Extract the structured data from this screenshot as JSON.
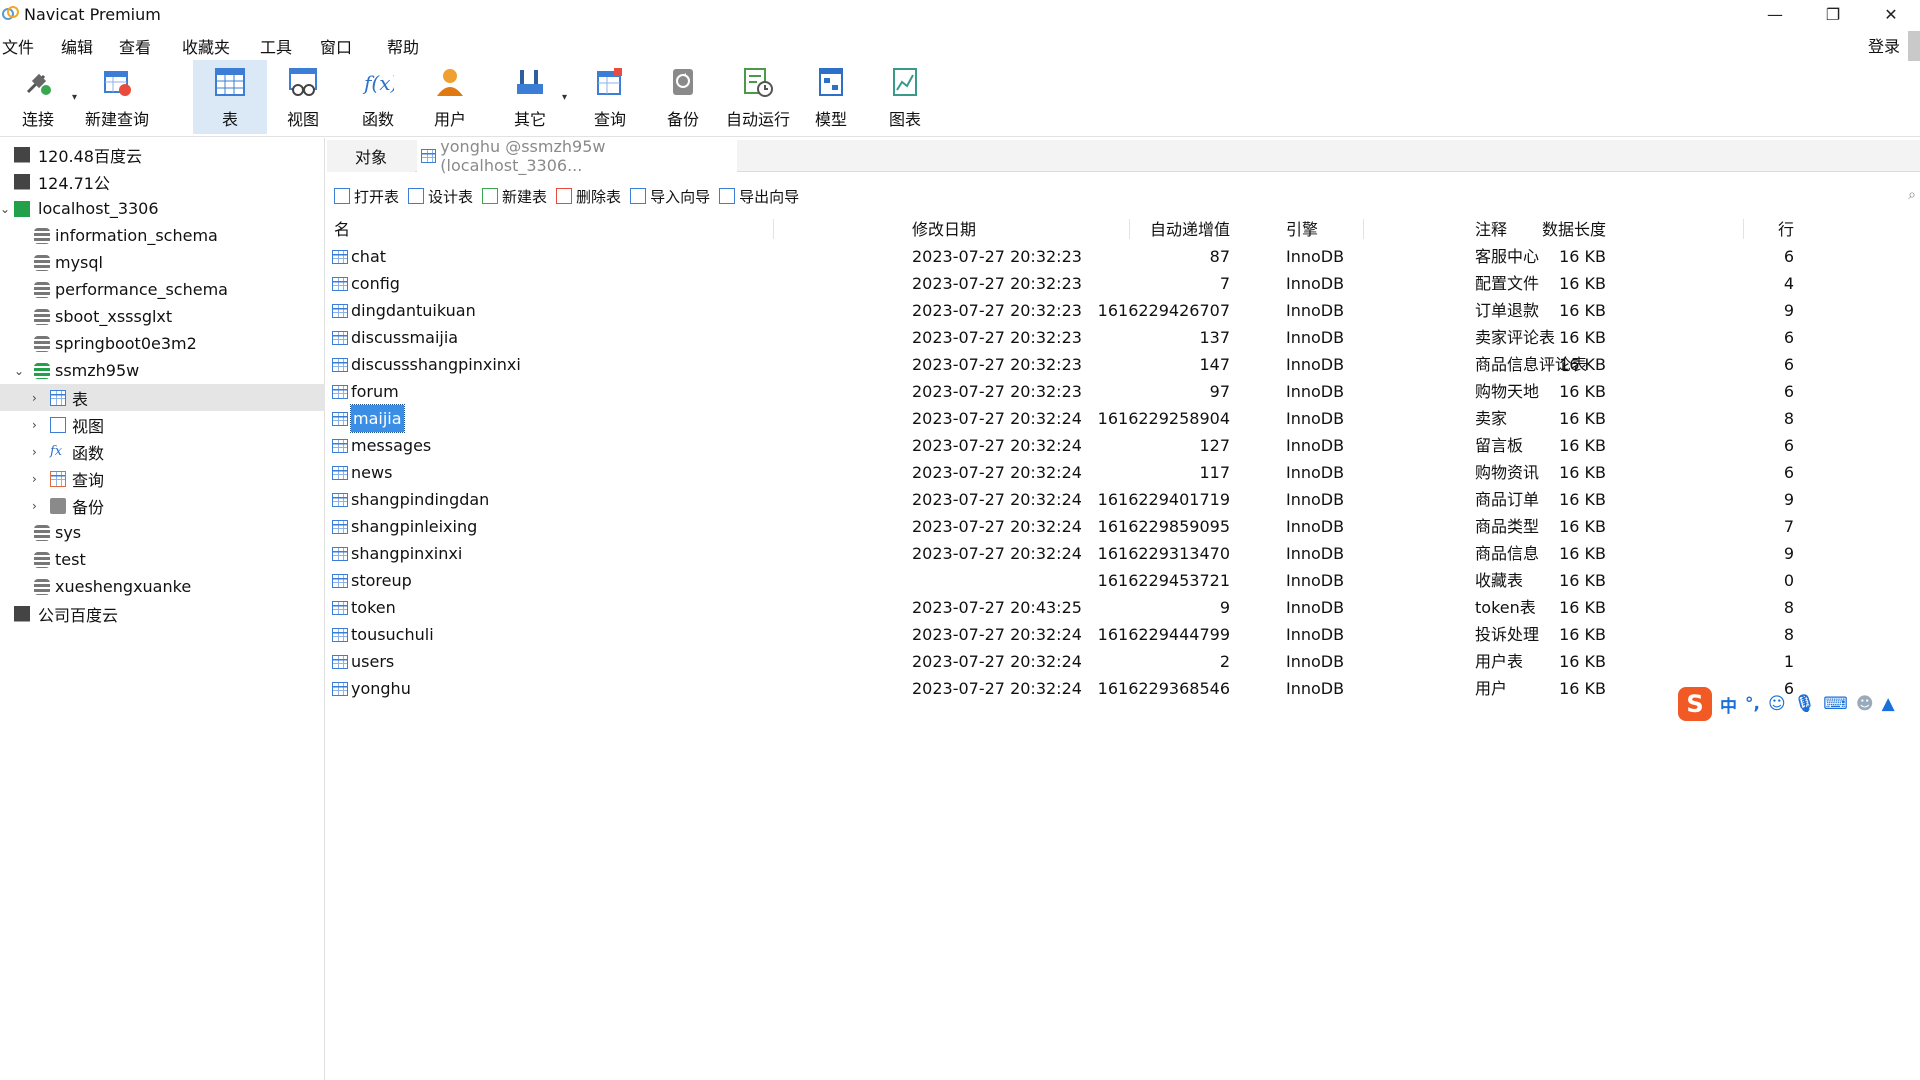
{
  "window": {
    "title": "Navicat Premium",
    "controls": [
      "—",
      "❐",
      "✕"
    ]
  },
  "menu": {
    "items": [
      "文件",
      "编辑",
      "查看",
      "收藏夹",
      "工具",
      "窗口",
      "帮助"
    ],
    "login": "登录"
  },
  "toolbar": {
    "items": [
      {
        "label": "连接",
        "icon": "plug-icon"
      },
      {
        "label": "新建查询",
        "icon": "new-query-icon"
      },
      {
        "label": "表",
        "icon": "table-icon",
        "active": true
      },
      {
        "label": "视图",
        "icon": "view-icon"
      },
      {
        "label": "函数",
        "icon": "function-icon"
      },
      {
        "label": "用户",
        "icon": "user-icon"
      },
      {
        "label": "其它",
        "icon": "tools-icon"
      },
      {
        "label": "查询",
        "icon": "query-icon"
      },
      {
        "label": "备份",
        "icon": "backup-icon"
      },
      {
        "label": "自动运行",
        "icon": "schedule-icon"
      },
      {
        "label": "模型",
        "icon": "model-icon"
      },
      {
        "label": "图表",
        "icon": "chart-icon"
      }
    ]
  },
  "sidebar": {
    "items": [
      {
        "label": "120.48百度云",
        "kind": "connection"
      },
      {
        "label": "124.71公",
        "kind": "connection"
      },
      {
        "label": "localhost_3306",
        "kind": "connection-open"
      },
      {
        "label": "information_schema",
        "kind": "db"
      },
      {
        "label": "mysql",
        "kind": "db"
      },
      {
        "label": "performance_schema",
        "kind": "db"
      },
      {
        "label": "sboot_xsssglxt",
        "kind": "db"
      },
      {
        "label": "springboot0e3m2",
        "kind": "db"
      },
      {
        "label": "ssmzh95w",
        "kind": "db-open"
      },
      {
        "label": "表",
        "kind": "tables"
      },
      {
        "label": "视图",
        "kind": "views"
      },
      {
        "label": "函数",
        "kind": "functions"
      },
      {
        "label": "查询",
        "kind": "queries"
      },
      {
        "label": "备份",
        "kind": "backups"
      },
      {
        "label": "sys",
        "kind": "db"
      },
      {
        "label": "test",
        "kind": "db"
      },
      {
        "label": "xueshengxuanke",
        "kind": "db"
      },
      {
        "label": "公司百度云",
        "kind": "connection"
      }
    ]
  },
  "tabs": {
    "objects": "对象",
    "query": "yonghu @ssmzh95w (localhost_3306..."
  },
  "actions": [
    "打开表",
    "设计表",
    "新建表",
    "删除表",
    "导入向导",
    "导出向导"
  ],
  "table": {
    "headers": {
      "name": "名",
      "auto_inc": "自动递增值",
      "modified": "修改日期",
      "data_length": "数据长度",
      "engine": "引擎",
      "rows": "行",
      "comment": "注释"
    },
    "rows": [
      {
        "name": "chat",
        "auto_inc": "87",
        "modified": "2023-07-27 20:32:23",
        "data_length": "16 KB",
        "engine": "InnoDB",
        "rows": "6",
        "comment": "客服中心"
      },
      {
        "name": "config",
        "auto_inc": "7",
        "modified": "2023-07-27 20:32:23",
        "data_length": "16 KB",
        "engine": "InnoDB",
        "rows": "4",
        "comment": "配置文件"
      },
      {
        "name": "dingdantuikuan",
        "auto_inc": "1616229426707",
        "modified": "2023-07-27 20:32:23",
        "data_length": "16 KB",
        "engine": "InnoDB",
        "rows": "9",
        "comment": "订单退款"
      },
      {
        "name": "discussmaijia",
        "auto_inc": "137",
        "modified": "2023-07-27 20:32:23",
        "data_length": "16 KB",
        "engine": "InnoDB",
        "rows": "6",
        "comment": "卖家评论表"
      },
      {
        "name": "discussshangpinxinxi",
        "auto_inc": "147",
        "modified": "2023-07-27 20:32:23",
        "data_length": "16 KB",
        "engine": "InnoDB",
        "rows": "6",
        "comment": "商品信息评论表"
      },
      {
        "name": "forum",
        "auto_inc": "97",
        "modified": "2023-07-27 20:32:23",
        "data_length": "16 KB",
        "engine": "InnoDB",
        "rows": "6",
        "comment": "购物天地"
      },
      {
        "name": "maijia",
        "auto_inc": "1616229258904",
        "modified": "2023-07-27 20:32:24",
        "data_length": "16 KB",
        "engine": "InnoDB",
        "rows": "8",
        "comment": "卖家",
        "selected": true
      },
      {
        "name": "messages",
        "auto_inc": "127",
        "modified": "2023-07-27 20:32:24",
        "data_length": "16 KB",
        "engine": "InnoDB",
        "rows": "6",
        "comment": "留言板"
      },
      {
        "name": "news",
        "auto_inc": "117",
        "modified": "2023-07-27 20:32:24",
        "data_length": "16 KB",
        "engine": "InnoDB",
        "rows": "6",
        "comment": "购物资讯"
      },
      {
        "name": "shangpindingdan",
        "auto_inc": "1616229401719",
        "modified": "2023-07-27 20:32:24",
        "data_length": "16 KB",
        "engine": "InnoDB",
        "rows": "9",
        "comment": "商品订单"
      },
      {
        "name": "shangpinleixing",
        "auto_inc": "1616229859095",
        "modified": "2023-07-27 20:32:24",
        "data_length": "16 KB",
        "engine": "InnoDB",
        "rows": "7",
        "comment": "商品类型"
      },
      {
        "name": "shangpinxinxi",
        "auto_inc": "1616229313470",
        "modified": "2023-07-27 20:32:24",
        "data_length": "16 KB",
        "engine": "InnoDB",
        "rows": "9",
        "comment": "商品信息"
      },
      {
        "name": "storeup",
        "auto_inc": "1616229453721",
        "modified": "",
        "data_length": "16 KB",
        "engine": "InnoDB",
        "rows": "0",
        "comment": "收藏表"
      },
      {
        "name": "token",
        "auto_inc": "9",
        "modified": "2023-07-27 20:43:25",
        "data_length": "16 KB",
        "engine": "InnoDB",
        "rows": "8",
        "comment": "token表"
      },
      {
        "name": "tousuchuli",
        "auto_inc": "1616229444799",
        "modified": "2023-07-27 20:32:24",
        "data_length": "16 KB",
        "engine": "InnoDB",
        "rows": "8",
        "comment": "投诉处理"
      },
      {
        "name": "users",
        "auto_inc": "2",
        "modified": "2023-07-27 20:32:24",
        "data_length": "16 KB",
        "engine": "InnoDB",
        "rows": "1",
        "comment": "用户表"
      },
      {
        "name": "yonghu",
        "auto_inc": "1616229368546",
        "modified": "2023-07-27 20:32:24",
        "data_length": "16 KB",
        "engine": "InnoDB",
        "rows": "6",
        "comment": "用户"
      }
    ]
  },
  "ime": {
    "logo": "S",
    "mode": "中",
    "punct": "°,"
  },
  "colors": {
    "accent": "#3a8ee6",
    "active_tool": "#dbe8f6",
    "selected_tree": "#e5e5e5",
    "ime_orange": "#f15a24"
  }
}
